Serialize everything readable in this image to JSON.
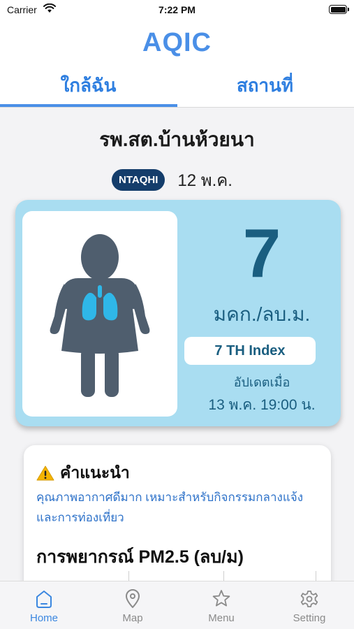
{
  "status_bar": {
    "carrier": "Carrier",
    "time": "7:22 PM"
  },
  "app": {
    "title": "AQIC"
  },
  "tabs": [
    {
      "label": "ใกล้ฉัน",
      "active": true
    },
    {
      "label": "สถานที่",
      "active": false
    }
  ],
  "station": {
    "name": "รพ.สต.บ้านห้วยนา",
    "badge": "NTAQHI",
    "date": "12 พ.ค."
  },
  "air_quality": {
    "value": "7",
    "unit": "มคก./ลบ.ม.",
    "index_label": "7 TH Index",
    "updated_label": "อัปเดตเมื่อ",
    "updated_time": "13 พ.ค. 19:00 น.",
    "card_color": "#a9ddf1",
    "text_color": "#1a5e80"
  },
  "advice": {
    "title": "คำแนะนำ",
    "text": "คุณภาพอากาศดีมาก เหมาะสำหรับกิจกรรมกลางแจ้งและการท่องเที่ยว"
  },
  "forecast": {
    "title": "การพยากรณ์ PM2.5 (ลบ/ม)"
  },
  "bottom_nav": [
    {
      "label": "Home",
      "icon": "home-icon",
      "active": true
    },
    {
      "label": "Map",
      "icon": "map-pin-icon",
      "active": false
    },
    {
      "label": "Menu",
      "icon": "star-icon",
      "active": false
    },
    {
      "label": "Setting",
      "icon": "gear-icon",
      "active": false
    }
  ],
  "colors": {
    "accent": "#4a8fe7",
    "badge_bg": "#143d6b",
    "lung": "#2fb7e8",
    "person": "#4f5e6e"
  }
}
